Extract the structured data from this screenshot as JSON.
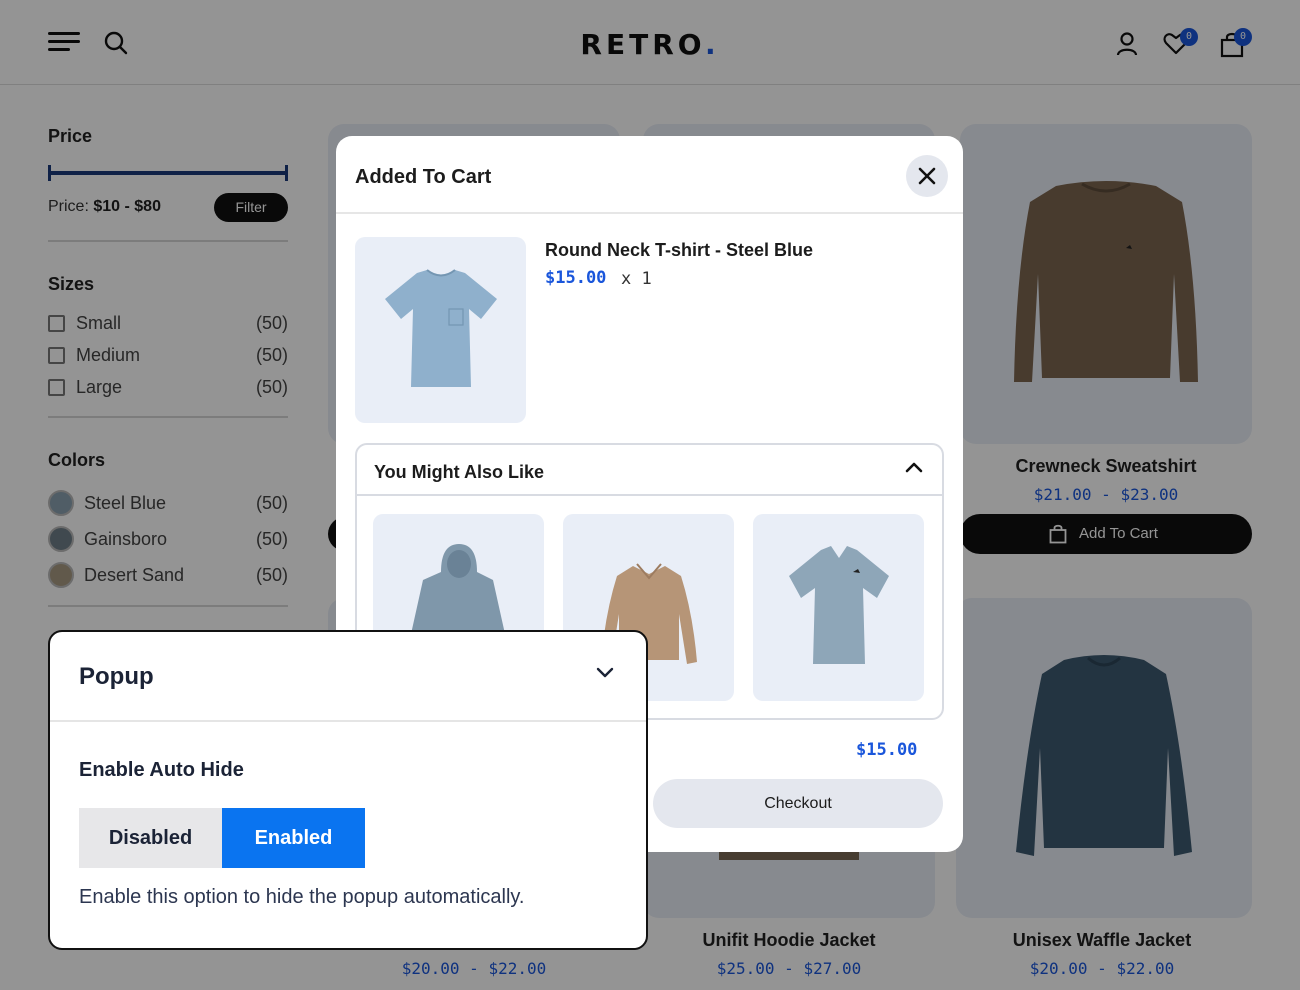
{
  "store": {
    "logo": "RETRO",
    "logo_dot": ".",
    "wishlist_count": "0",
    "cart_count": "0"
  },
  "filters": {
    "price_title": "Price",
    "price_label": "Price:",
    "price_range": "$10 - $80",
    "filter_button": "Filter",
    "sizes_title": "Sizes",
    "sizes": [
      {
        "label": "Small",
        "count": "(50)"
      },
      {
        "label": "Medium",
        "count": "(50)"
      },
      {
        "label": "Large",
        "count": "(50)"
      }
    ],
    "colors_title": "Colors",
    "colors": [
      {
        "label": "Steel Blue",
        "count": "(50)",
        "swatch": "#8aa0b0"
      },
      {
        "label": "Gainsboro",
        "count": "(50)",
        "swatch": "#6f7f88"
      },
      {
        "label": "Desert Sand",
        "count": "(50)",
        "swatch": "#a89a82"
      }
    ]
  },
  "products": [
    {
      "name": "Crewneck Sweatshirt",
      "price": "$21.00 - $23.00",
      "add_to_cart": "Add To Cart"
    },
    {
      "name": "Unifit Hoodie Jacket",
      "price": "$25.00 - $27.00"
    },
    {
      "name": "Unisex Waffle Jacket",
      "price": "$20.00 - $22.00"
    },
    {
      "price": "$20.00 - $22.00"
    }
  ],
  "cart_modal": {
    "title": "Added To Cart",
    "item_name": "Round Neck T-shirt - Steel Blue",
    "item_price": "$15.00",
    "item_qty": "x 1",
    "also_like_title": "You Might Also Like",
    "subtotal": "$15.00",
    "checkout_label": "Checkout"
  },
  "settings_panel": {
    "title": "Popup",
    "setting_label": "Enable Auto Hide",
    "option_disabled": "Disabled",
    "option_enabled": "Enabled",
    "selected": "Enabled",
    "help_text": "Enable this option to hide the popup automatically."
  },
  "colors": {
    "accent": "#1a56db",
    "toggle_active": "#0a74f0"
  }
}
